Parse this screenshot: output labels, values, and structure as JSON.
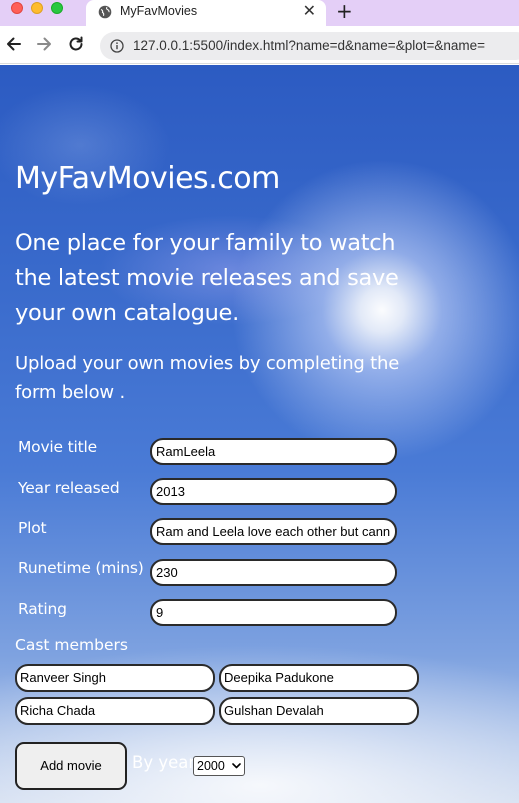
{
  "browser": {
    "tab_title": "MyFavMovies",
    "tab_close": "✕",
    "new_tab": "+",
    "url": "127.0.0.1:5500/index.html?name=d&name=&plot=&name="
  },
  "header": {
    "site_title": "MyFavMovies.com",
    "tagline": "One place for your family to watch the latest movie releases and save your own catalogue.",
    "subhead": "Upload your own movies by completing the form below ."
  },
  "form": {
    "fields": [
      {
        "label": "Movie title",
        "value": "RamLeela"
      },
      {
        "label": "Year released",
        "value": "2013"
      },
      {
        "label": "Plot",
        "value": "Ram and Leela love each other but cann"
      },
      {
        "label": "Runetime (mins)",
        "value": "230"
      },
      {
        "label": "Rating",
        "value": "9"
      }
    ],
    "cast_label": "Cast members",
    "cast": [
      "Ranveer Singh",
      "Deepika Padukone",
      "Richa Chada",
      "Gulshan Devalah"
    ],
    "add_button": "Add movie",
    "by_year_label": "By year",
    "year_selected": "2000"
  }
}
